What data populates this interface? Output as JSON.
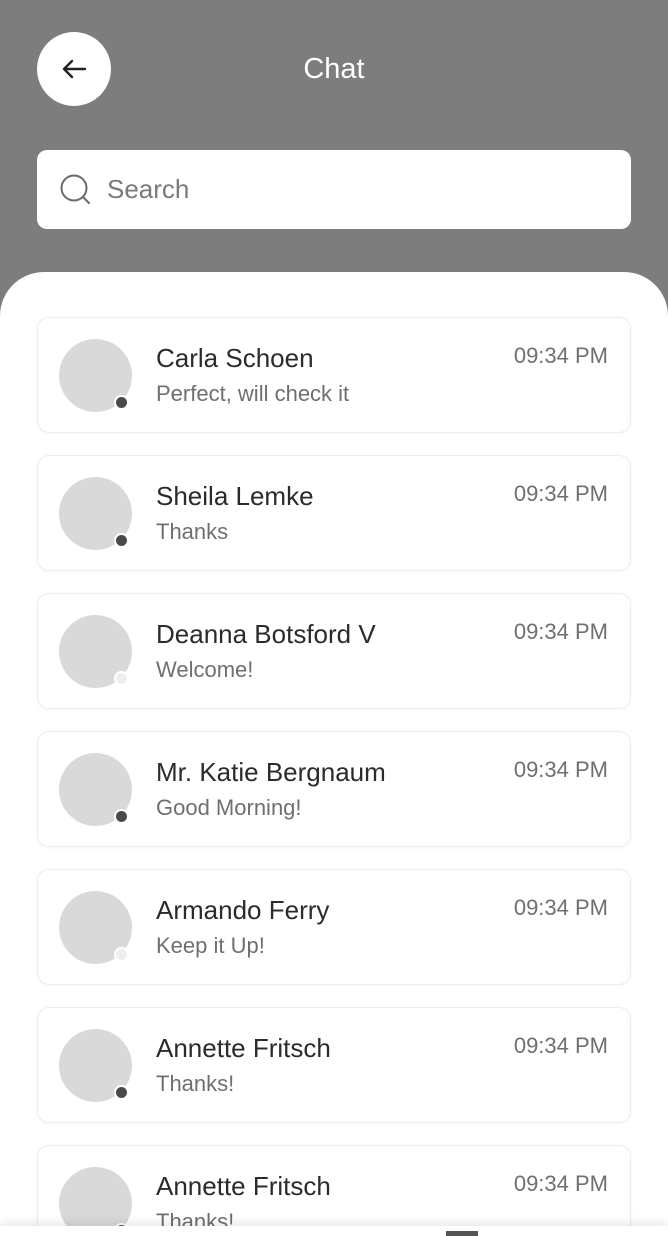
{
  "header": {
    "title": "Chat",
    "back_icon": "arrow-left-icon"
  },
  "search": {
    "placeholder": "Search",
    "value": "",
    "icon": "search-icon"
  },
  "chats": [
    {
      "name": "Carla Schoen",
      "message": "Perfect, will check it",
      "time": "09:34 PM",
      "status": "online"
    },
    {
      "name": "Sheila Lemke",
      "message": "Thanks",
      "time": "09:34 PM",
      "status": "online"
    },
    {
      "name": "Deanna Botsford V",
      "message": "Welcome!",
      "time": "09:34 PM",
      "status": "offline"
    },
    {
      "name": "Mr. Katie Bergnaum",
      "message": "Good Morning!",
      "time": "09:34 PM",
      "status": "online"
    },
    {
      "name": "Armando Ferry",
      "message": "Keep it Up!",
      "time": "09:34 PM",
      "status": "offline"
    },
    {
      "name": "Annette Fritsch",
      "message": "Thanks!",
      "time": "09:34 PM",
      "status": "online"
    },
    {
      "name": "Annette Fritsch",
      "message": "Thanks!",
      "time": "09:34 PM",
      "status": "online"
    }
  ],
  "colors": {
    "header_bg": "#7d7d7d",
    "sheet_bg": "#ffffff",
    "online_dot": "#4a4a4a",
    "offline_dot": "#eeeeee"
  }
}
